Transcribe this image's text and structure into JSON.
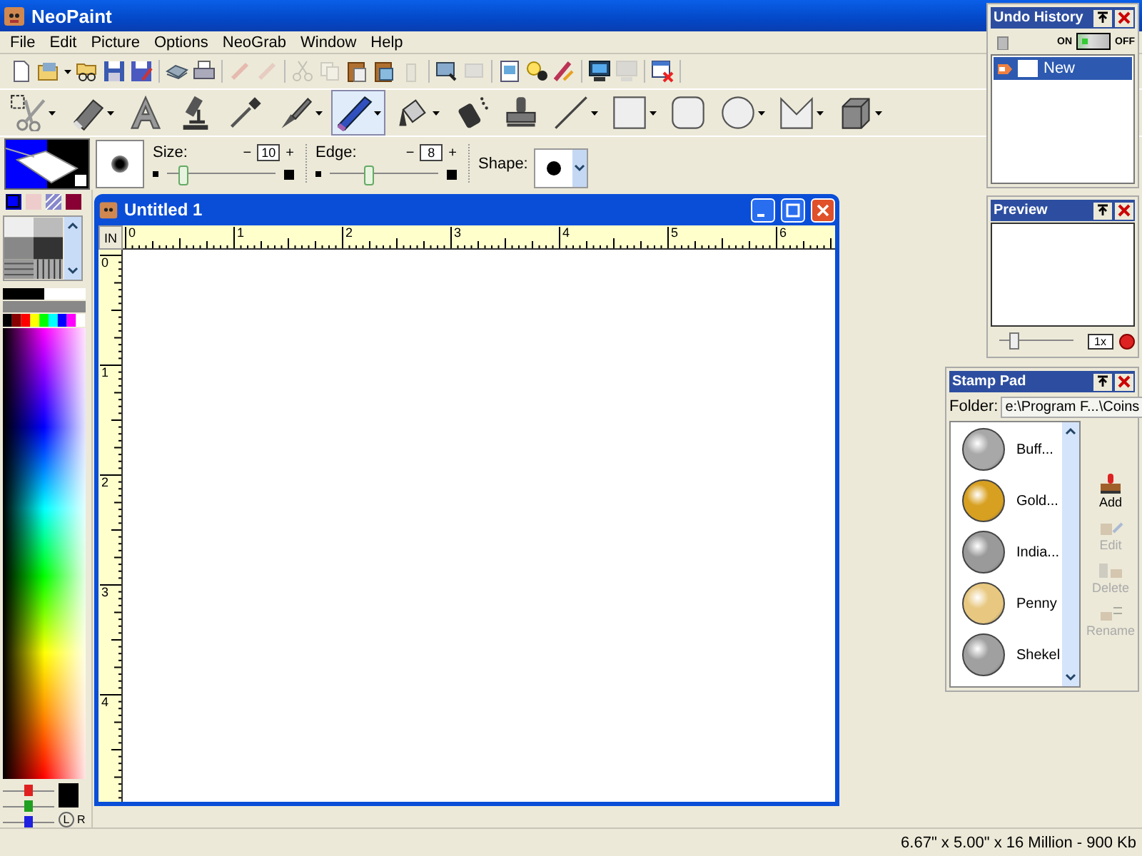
{
  "window": {
    "title": "NeoPaint"
  },
  "menu": [
    {
      "label": "File"
    },
    {
      "label": "Edit"
    },
    {
      "label": "Picture"
    },
    {
      "label": "Options"
    },
    {
      "label": "NeoGrab"
    },
    {
      "label": "Window"
    },
    {
      "label": "Help"
    }
  ],
  "toolbar": [
    {
      "items": [
        {
          "kind": "new",
          "disabled": false,
          "menu": false
        },
        {
          "kind": "open",
          "disabled": false,
          "menu": true
        },
        {
          "kind": "browse",
          "disabled": false,
          "menu": false
        },
        {
          "kind": "save",
          "disabled": false,
          "menu": false
        },
        {
          "kind": "saveall",
          "disabled": false,
          "menu": false
        }
      ]
    },
    {
      "items": [
        {
          "kind": "scan",
          "disabled": false,
          "menu": false
        },
        {
          "kind": "print",
          "disabled": false,
          "menu": false
        }
      ]
    },
    {
      "items": [
        {
          "kind": "undo",
          "disabled": true,
          "menu": false
        },
        {
          "kind": "redo",
          "disabled": true,
          "menu": false
        }
      ]
    },
    {
      "items": [
        {
          "kind": "cut",
          "disabled": true,
          "menu": false
        },
        {
          "kind": "copy",
          "disabled": true,
          "menu": false
        },
        {
          "kind": "paste",
          "disabled": false,
          "menu": false
        },
        {
          "kind": "pastenew",
          "disabled": false,
          "menu": false
        },
        {
          "kind": "delete",
          "disabled": true,
          "menu": false
        }
      ]
    },
    {
      "items": [
        {
          "kind": "crop",
          "disabled": false,
          "menu": false
        },
        {
          "kind": "autocrop",
          "disabled": true,
          "menu": false
        }
      ]
    },
    {
      "items": [
        {
          "kind": "properties",
          "disabled": false,
          "menu": false
        },
        {
          "kind": "brightness",
          "disabled": false,
          "menu": false
        },
        {
          "kind": "effects",
          "disabled": false,
          "menu": false
        }
      ]
    },
    {
      "items": [
        {
          "kind": "grab",
          "disabled": false,
          "menu": false
        },
        {
          "kind": "grabarea",
          "disabled": true,
          "menu": false
        }
      ]
    },
    {
      "items": [
        {
          "kind": "closewin",
          "disabled": false,
          "menu": false
        }
      ]
    }
  ],
  "tools": [
    {
      "kind": "select",
      "selected": false,
      "menu": true
    },
    {
      "kind": "eraser",
      "selected": false,
      "menu": true
    },
    {
      "kind": "text",
      "selected": false,
      "menu": false
    },
    {
      "kind": "zoom",
      "selected": false,
      "menu": false
    },
    {
      "kind": "dropper",
      "selected": false,
      "menu": false
    },
    {
      "kind": "brush",
      "selected": false,
      "menu": true
    },
    {
      "kind": "marker",
      "selected": true,
      "menu": true
    },
    {
      "kind": "bucket",
      "selected": false,
      "menu": true
    },
    {
      "kind": "spray",
      "selected": false,
      "menu": false
    },
    {
      "kind": "stamp",
      "selected": false,
      "menu": false
    },
    {
      "kind": "line",
      "selected": false,
      "menu": true
    },
    {
      "kind": "rect",
      "selected": false,
      "menu": true
    },
    {
      "kind": "roundrect",
      "selected": false,
      "menu": false
    },
    {
      "kind": "ellipse",
      "selected": false,
      "menu": true
    },
    {
      "kind": "polygon",
      "selected": false,
      "menu": true
    },
    {
      "kind": "cube",
      "selected": false,
      "menu": true
    }
  ],
  "options": {
    "size": {
      "label": "Size:",
      "minus": "−",
      "value": "10",
      "plus": "+",
      "level": 0.15
    },
    "edge": {
      "label": "Edge:",
      "minus": "−",
      "value": "8",
      "plus": "+",
      "level": 0.35
    },
    "shape": {
      "label": "Shape:"
    }
  },
  "palette": {
    "current": {
      "color": "#000000"
    },
    "rgb": [
      {
        "color": "#e02020",
        "level": 0.5
      },
      {
        "color": "#20a020",
        "level": 0.5
      },
      {
        "color": "#2020e0",
        "level": 0.5
      }
    ],
    "left": "L",
    "right": "R"
  },
  "document": {
    "title": "Untitled 1",
    "unit": "IN",
    "h_ruler": [
      "0",
      "1",
      "2",
      "3",
      "4",
      "5",
      "6"
    ],
    "v_ruler": [
      "0",
      "1",
      "2",
      "3",
      "4"
    ]
  },
  "undo_history": {
    "title": "Undo History",
    "on": "ON",
    "off": "OFF",
    "enabled": true,
    "items": [
      {
        "label": "New",
        "selected": true
      }
    ]
  },
  "preview": {
    "title": "Preview",
    "zoom": "1x",
    "level": 0.2
  },
  "stamp_pad": {
    "title": "Stamp Pad",
    "folder_label": "Folder:",
    "folder": "e:\\Program F...\\Coins",
    "stamps": [
      {
        "label": "Buff...",
        "color": "#a8a8a8"
      },
      {
        "label": "Gold...",
        "color": "#d8a020"
      },
      {
        "label": "India...",
        "color": "#9a9a9a"
      },
      {
        "label": "Penny",
        "color": "#e8c880"
      },
      {
        "label": "Shekel",
        "color": "#a0a0a0"
      }
    ],
    "buttons": [
      {
        "label": "Add",
        "disabled": false
      },
      {
        "label": "Edit",
        "disabled": true
      },
      {
        "label": "Delete",
        "disabled": true
      },
      {
        "label": "Rename",
        "disabled": true
      }
    ]
  },
  "status_bar": {
    "text": "6.67\" x 5.00\" x 16 Million - 900 Kb"
  }
}
